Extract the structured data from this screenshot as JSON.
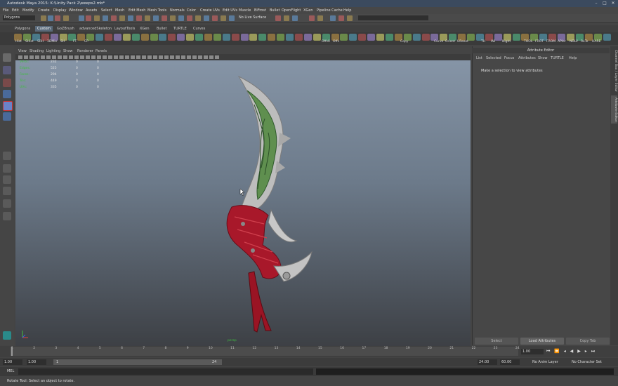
{
  "window": {
    "title": "Autodesk Maya 2015: K:\\Unity Pack 2\\weeps2.mb*"
  },
  "menubar": [
    "File",
    "Edit",
    "Modify",
    "Create",
    "Display",
    "Window",
    "Assets",
    "Select",
    "Mesh",
    "Edit Mesh",
    "Mesh Tools",
    "Normals",
    "Color",
    "Create UVs",
    "Edit UVs",
    "Muscle",
    "BiFrost",
    "Bullet",
    "OpenFlight",
    "XGen",
    "Pipeline Cache",
    "Help"
  ],
  "statusline": {
    "menuset": "Polygons",
    "live_surface": "No Live Surface"
  },
  "shelf_tabs": [
    "Polygons",
    "Custom",
    "GoZBrush",
    "advancedSkeleton",
    "LayoutTools",
    "XGen",
    "Bullet",
    "TURTLE",
    "Curves"
  ],
  "shelf_active": "Custom",
  "shelf_labels": [
    "Hist",
    "SHist",
    "SRH",
    "3DMix",
    "SH",
    "FT",
    "CP",
    "Offs0",
    "Offs",
    "Copy",
    "Curve",
    "Orient",
    "UReset",
    "TH",
    "INI",
    "Night",
    "TOOL",
    "FROT",
    "FROM",
    "APIer",
    "NDLV",
    "ReTe",
    "HARE"
  ],
  "viewport": {
    "menu": [
      "View",
      "Shading",
      "Lighting",
      "Show",
      "Renderer",
      "Panels"
    ],
    "hud": [
      {
        "label": "Verts:",
        "v1": "232",
        "v2": "0",
        "v3": "0"
      },
      {
        "label": "Edges:",
        "v1": "525",
        "v2": "0",
        "v3": "0"
      },
      {
        "label": "Faces:",
        "v1": "294",
        "v2": "0",
        "v3": "0"
      },
      {
        "label": "Tris:",
        "v1": "449",
        "v2": "0",
        "v3": "0"
      },
      {
        "label": "UVs:",
        "v1": "335",
        "v2": "0",
        "v3": "0"
      }
    ],
    "camera": "persp"
  },
  "attribute_editor": {
    "title": "Attribute Editor",
    "menu": [
      "List",
      "Selected",
      "Focus",
      "Attributes",
      "Show",
      "TURTLE",
      "Help"
    ],
    "message": "Make a selection to view attributes",
    "buttons": [
      "Select",
      "Load Attributes",
      "Copy Tab"
    ]
  },
  "side_tabs": [
    "Channel Box / Layer Editor",
    "Attribute Editor"
  ],
  "timeline": {
    "ticks": [
      "1",
      "2",
      "3",
      "4",
      "5",
      "6",
      "7",
      "8",
      "9",
      "10",
      "11",
      "12",
      "13",
      "14",
      "15",
      "16",
      "17",
      "18",
      "19",
      "20",
      "21",
      "22",
      "23",
      "24"
    ],
    "current_frame": "1.00"
  },
  "range": {
    "start": "1.00",
    "start2": "1.00",
    "slider_start": "1",
    "slider_end": "24",
    "end": "24.00",
    "end2": "60.00",
    "anim_layer": "No Anim Layer",
    "char_set": "No Character Set"
  },
  "cmdline": {
    "label": "MEL"
  },
  "helpline": {
    "text": "Rotate Tool: Select an object to rotate."
  },
  "colors": {
    "accent": "#5a6a7a",
    "hud_label": "#3fbf3f",
    "blade": "#cfcfcf",
    "wrap": "#a8182a",
    "inlay": "#5a8a4a"
  }
}
